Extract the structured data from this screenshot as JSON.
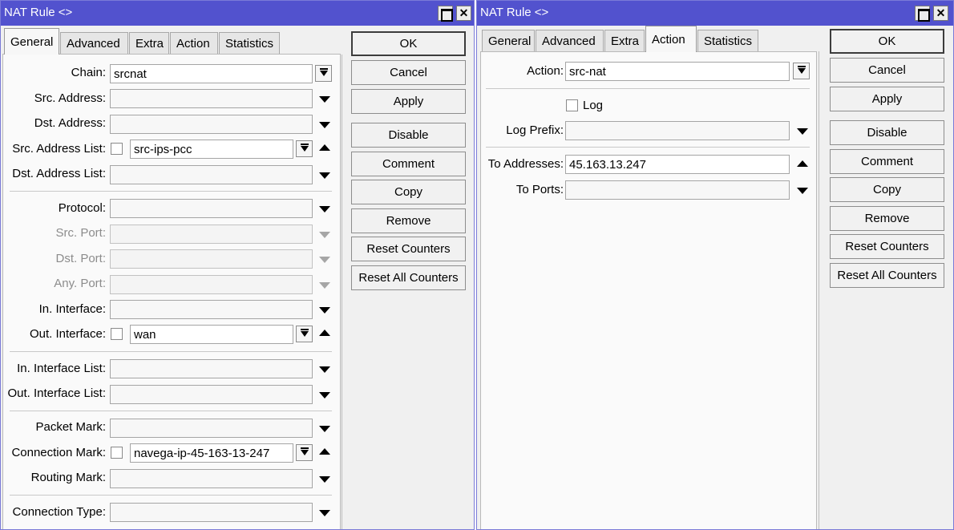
{
  "left": {
    "title": "NAT Rule <>",
    "tabs": [
      "General",
      "Advanced",
      "Extra",
      "Action",
      "Statistics"
    ],
    "active_tab": "General",
    "fields": {
      "chain": {
        "label": "Chain:",
        "value": "srcnat"
      },
      "src_address": {
        "label": "Src. Address:",
        "value": ""
      },
      "dst_address": {
        "label": "Dst. Address:",
        "value": ""
      },
      "src_address_list": {
        "label": "Src. Address List:",
        "value": "src-ips-pcc"
      },
      "dst_address_list": {
        "label": "Dst. Address List:",
        "value": ""
      },
      "protocol": {
        "label": "Protocol:",
        "value": ""
      },
      "src_port": {
        "label": "Src. Port:",
        "value": ""
      },
      "dst_port": {
        "label": "Dst. Port:",
        "value": ""
      },
      "any_port": {
        "label": "Any. Port:",
        "value": ""
      },
      "in_interface": {
        "label": "In. Interface:",
        "value": ""
      },
      "out_interface": {
        "label": "Out. Interface:",
        "value": "wan"
      },
      "in_interface_list": {
        "label": "In. Interface List:",
        "value": ""
      },
      "out_interface_list": {
        "label": "Out. Interface List:",
        "value": ""
      },
      "packet_mark": {
        "label": "Packet Mark:",
        "value": ""
      },
      "connection_mark": {
        "label": "Connection Mark:",
        "value": "navega-ip-45-163-13-247"
      },
      "routing_mark": {
        "label": "Routing Mark:",
        "value": ""
      },
      "connection_type": {
        "label": "Connection Type:",
        "value": ""
      }
    },
    "buttons": [
      "OK",
      "Cancel",
      "Apply",
      "Disable",
      "Comment",
      "Copy",
      "Remove",
      "Reset Counters",
      "Reset All Counters"
    ]
  },
  "right": {
    "title": "NAT Rule <>",
    "tabs": [
      "General",
      "Advanced",
      "Extra",
      "Action",
      "Statistics"
    ],
    "active_tab": "Action",
    "fields": {
      "action": {
        "label": "Action:",
        "value": "src-nat"
      },
      "log": {
        "label": "Log",
        "checked": false
      },
      "log_prefix": {
        "label": "Log Prefix:",
        "value": ""
      },
      "to_addresses": {
        "label": "To Addresses:",
        "value": "45.163.13.247"
      },
      "to_ports": {
        "label": "To Ports:",
        "value": ""
      }
    },
    "buttons": [
      "OK",
      "Cancel",
      "Apply",
      "Disable",
      "Comment",
      "Copy",
      "Remove",
      "Reset Counters",
      "Reset All Counters"
    ]
  },
  "colors": {
    "titlebar": "#5252ce",
    "window_border": "#7a7ad8",
    "background": "#f0f0f0"
  }
}
